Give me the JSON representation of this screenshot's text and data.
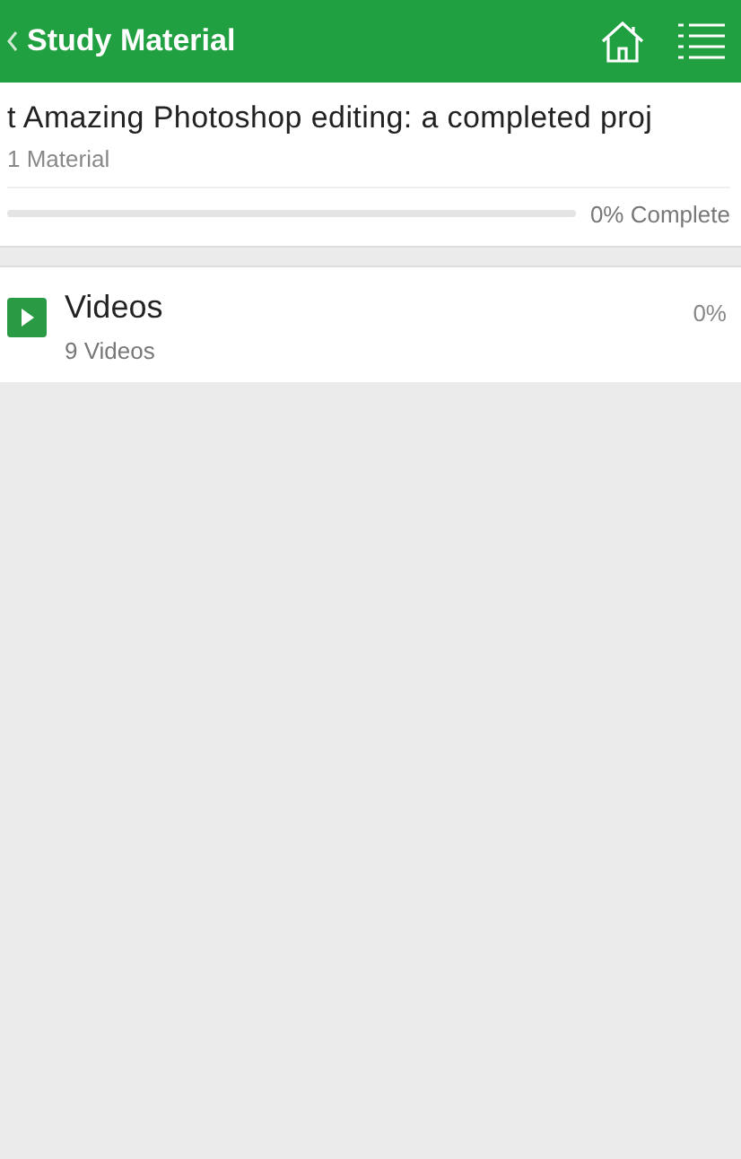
{
  "header": {
    "title": "Study Material"
  },
  "course": {
    "title": "t Amazing Photoshop editing: a completed proj",
    "count": "1 Material",
    "progress": {
      "level": 0,
      "reading": "0% Complete"
    }
  },
  "sections": [
    {
      "kind": "video",
      "title": "Videos",
      "count": "9 Videos",
      "percent": "0%"
    }
  ]
}
